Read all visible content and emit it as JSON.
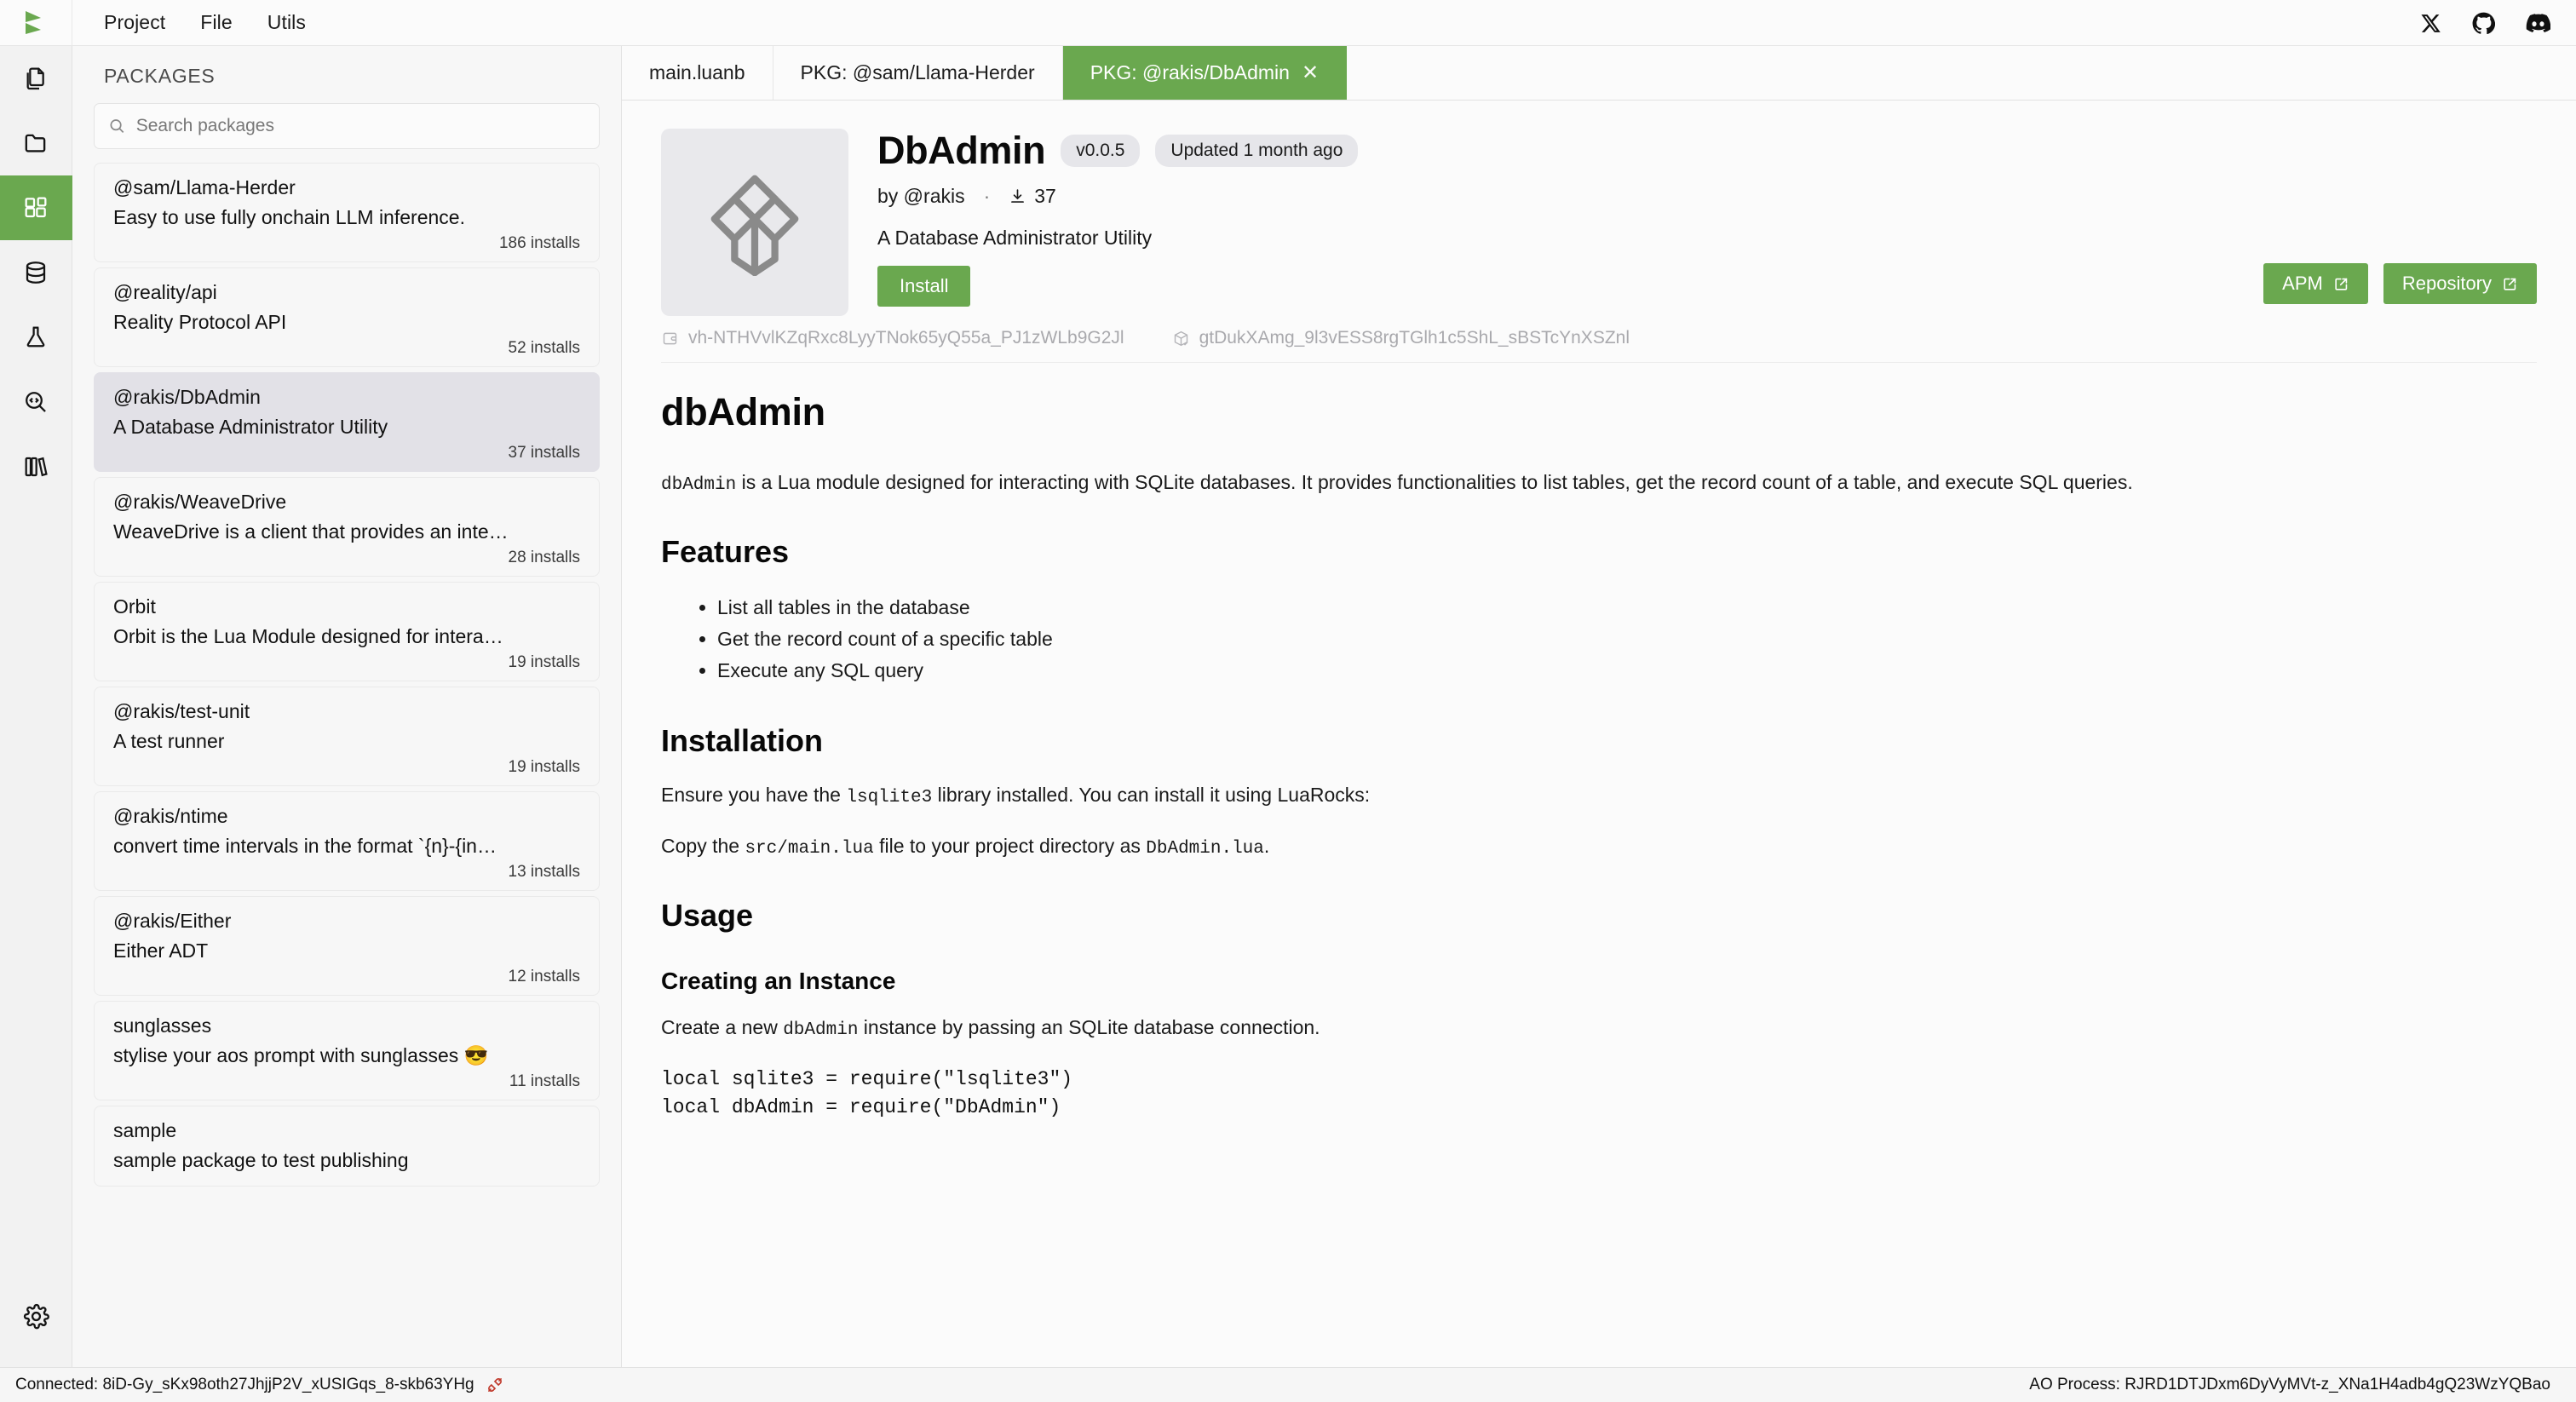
{
  "app": {
    "logo_icon": "betteridea-play-logo"
  },
  "menubar": {
    "items": [
      {
        "label": "Project",
        "icon": "none"
      },
      {
        "label": "File",
        "icon": "none"
      },
      {
        "label": "Utils",
        "icon": "none"
      }
    ],
    "social": [
      {
        "name": "x-twitter-icon",
        "label": "X"
      },
      {
        "name": "github-icon",
        "label": "GitHub"
      },
      {
        "name": "discord-icon",
        "label": "Discord"
      }
    ]
  },
  "activitybar": {
    "items": [
      {
        "icon": "files-copy-icon",
        "label": "Files",
        "active": false
      },
      {
        "icon": "folder-icon",
        "label": "Folder",
        "active": false
      },
      {
        "icon": "packages-grid-icon",
        "label": "Packages",
        "active": true
      },
      {
        "icon": "database-icon",
        "label": "Database",
        "active": false
      },
      {
        "icon": "flask-icon",
        "label": "Experiments",
        "active": false
      },
      {
        "icon": "code-search-icon",
        "label": "Code Search",
        "active": false
      },
      {
        "icon": "library-books-icon",
        "label": "Library",
        "active": false
      }
    ],
    "bottom": {
      "icon": "gear-icon",
      "label": "Settings"
    }
  },
  "packages_panel": {
    "title": "PACKAGES",
    "search": {
      "placeholder": "Search packages",
      "value": "",
      "icon": "search-icon"
    },
    "items": [
      {
        "name": "@sam/Llama-Herder",
        "description": "Easy to use fully onchain LLM inference.",
        "installs": "186 installs",
        "selected": false
      },
      {
        "name": "@reality/api",
        "description": "Reality Protocol API",
        "installs": "52 installs",
        "selected": false
      },
      {
        "name": "@rakis/DbAdmin",
        "description": "A Database Administrator Utility",
        "installs": "37 installs",
        "selected": true
      },
      {
        "name": "@rakis/WeaveDrive",
        "description": "WeaveDrive is a client that provides an inte…",
        "installs": "28 installs",
        "selected": false
      },
      {
        "name": "Orbit",
        "description": "Orbit is the Lua Module designed for intera…",
        "installs": "19 installs",
        "selected": false
      },
      {
        "name": "@rakis/test-unit",
        "description": "A test runner",
        "installs": "19 installs",
        "selected": false
      },
      {
        "name": "@rakis/ntime",
        "description": "convert time intervals in the format `{n}-{in…",
        "installs": "13 installs",
        "selected": false
      },
      {
        "name": "@rakis/Either",
        "description": "Either ADT",
        "installs": "12 installs",
        "selected": false
      },
      {
        "name": "sunglasses",
        "description": "stylise your aos prompt with sunglasses 😎",
        "installs": "11 installs",
        "selected": false
      },
      {
        "name": "sample",
        "description": "sample package to test publishing",
        "installs": "",
        "selected": false
      }
    ]
  },
  "tabs": [
    {
      "label": "main.luanb",
      "active": false,
      "closable": false
    },
    {
      "label": "PKG: @sam/Llama-Herder",
      "active": false,
      "closable": false
    },
    {
      "label": "PKG: @rakis/DbAdmin",
      "active": true,
      "closable": true,
      "close_icon": "close-icon"
    }
  ],
  "package_header": {
    "logo_icon": "package-box-logo",
    "title": "DbAdmin",
    "version": "v0.0.5",
    "updated": "Updated 1 month ago",
    "author": "by @rakis",
    "separator": "·",
    "downloads_icon": "download-icon",
    "downloads": "37",
    "tagline": "A Database Administrator Utility",
    "install_label": "Install",
    "actions": [
      {
        "label": "APM",
        "icon": "external-link-icon"
      },
      {
        "label": "Repository",
        "icon": "external-link-icon"
      }
    ],
    "ids": [
      {
        "icon": "wallet-id-icon",
        "value": "vh-NTHVvlKZqRxc8LyyTNok65yQ55a_PJ1zWLb9G2Jl"
      },
      {
        "icon": "package-check-icon",
        "value": "gtDukXAmg_9l3vESS8rgTGlh1c5ShL_sBSTcYnXSZnl"
      }
    ]
  },
  "readme": {
    "h1": "dbAdmin",
    "intro_a": "dbAdmin",
    "intro_b": " is a Lua module designed for interacting with SQLite databases. It provides functionalities to list tables, get the record count of a table, and execute SQL queries.",
    "features_heading": "Features",
    "features": [
      "List all tables in the database",
      "Get the record count of a specific table",
      "Execute any SQL query"
    ],
    "installation_heading": "Installation",
    "install_p1_a": "Ensure you have the ",
    "install_p1_code": "lsqlite3",
    "install_p1_b": " library installed. You can install it using LuaRocks:",
    "install_p2_a": "Copy the ",
    "install_p2_code1": "src/main.lua",
    "install_p2_b": " file to your project directory as ",
    "install_p2_code2": "DbAdmin.lua",
    "install_p2_c": ".",
    "usage_heading": "Usage",
    "creating_heading": "Creating an Instance",
    "creating_p_a": "Create a new ",
    "creating_p_code": "dbAdmin",
    "creating_p_b": " instance by passing an SQLite database connection.",
    "code_line_1": "local sqlite3 = require(\"lsqlite3\")",
    "code_line_2": "local dbAdmin = require(\"DbAdmin\")"
  },
  "statusbar": {
    "connected": "Connected: 8iD-Gy_sKx98oth27JhjjP2V_xUSIGqs_8-skb63YHg",
    "plug_icon": "plug-disconnect-icon",
    "process": "AO Process: RJRD1DTJDxm6DyVyMVt-z_XNa1H4adb4gQ23WzYQBao"
  },
  "colors": {
    "accent_green": "#6aa84f",
    "panel_bg": "#f7f7f7",
    "selected_item": "#e2e1e7",
    "chip_bg": "#e6e6ea"
  }
}
